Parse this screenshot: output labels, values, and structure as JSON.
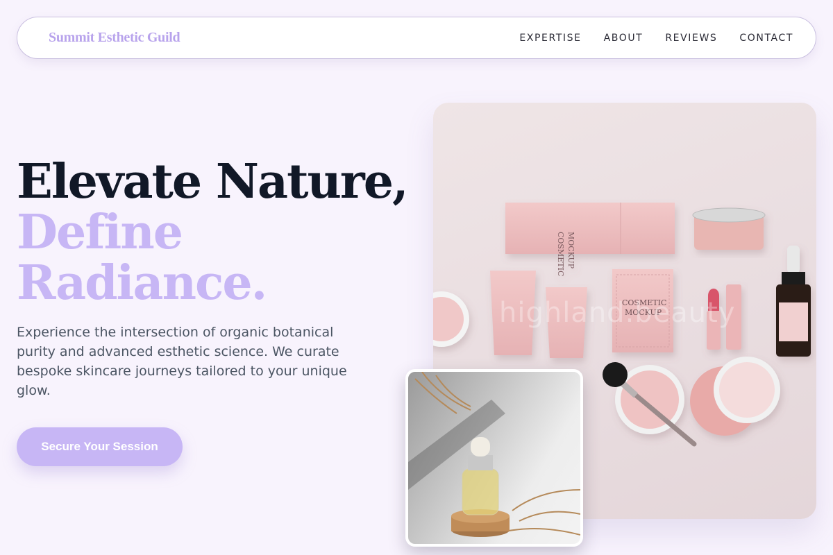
{
  "brand": {
    "name": "Summit Esthetic Guild"
  },
  "nav": {
    "links": [
      "EXPERTISE",
      "ABOUT",
      "REVIEWS",
      "CONTACT"
    ]
  },
  "hero": {
    "headline_line1": "Elevate Nature,",
    "headline_line2": "Define",
    "headline_line3": "Radiance.",
    "description": "Experience the intersection of organic botanical purity and advanced esthetic science. We curate bespoke skincare journeys tailored to your unique glow.",
    "cta_label": "Secure Your Session"
  },
  "images": {
    "main_watermark": "highland.beauty",
    "main_box_lettering": "COSMETIC MOCKUP",
    "inset_description_icon": "serum-bottle-icon"
  },
  "colors": {
    "accent": "#c7b6f5",
    "brand": "#b8a3ec",
    "heading": "#111827",
    "body_text": "#4b5563",
    "background": "#f8f3fd"
  }
}
